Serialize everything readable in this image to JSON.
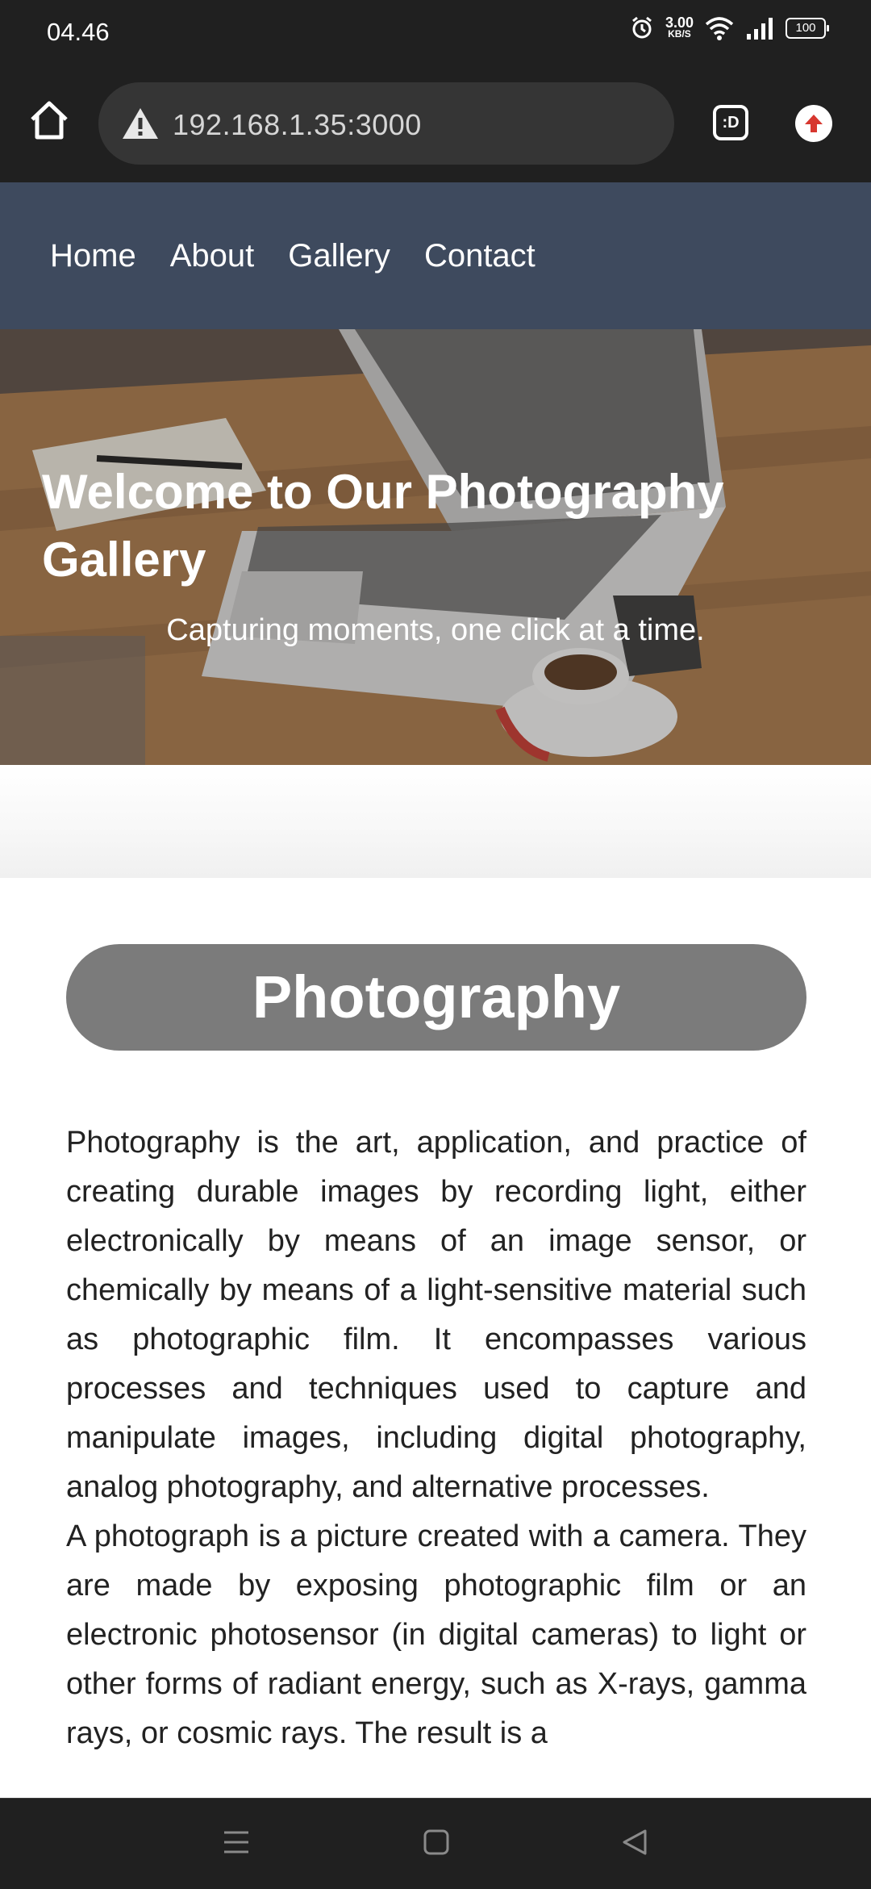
{
  "status_bar": {
    "time": "04.46",
    "network_speed": "3.00",
    "network_unit": "KB/S",
    "battery": "100"
  },
  "browser": {
    "url": "192.168.1.35:3000",
    "tab_switcher_label": ":D"
  },
  "site_nav": {
    "items": [
      {
        "label": "Home"
      },
      {
        "label": "About"
      },
      {
        "label": "Gallery"
      },
      {
        "label": "Contact"
      }
    ]
  },
  "hero": {
    "title": "Welcome to Our Photography Gallery",
    "subtitle": "Capturing moments, one click at a time."
  },
  "section": {
    "heading": "Photography",
    "paragraphs": [
      "Photography is the art, application, and practice of creating durable images by recording light, either electronically by means of an image sensor, or chemically by means of a light-sensitive material such as photographic film. It encompasses various processes and techniques used to capture and manipulate images, including digital photography, analog photography, and alternative processes.",
      "A photograph is a picture created with a camera. They are made by exposing photographic film or an electronic photosensor (in digital cameras) to light or other forms of radiant energy, such as X-rays, gamma rays, or cosmic rays. The result is a"
    ]
  },
  "icons": {
    "home": "home-icon",
    "warning": "warning-icon",
    "upload": "upload-icon",
    "menu": "menu-icon",
    "square": "home-square-icon",
    "back": "back-triangle-icon"
  }
}
